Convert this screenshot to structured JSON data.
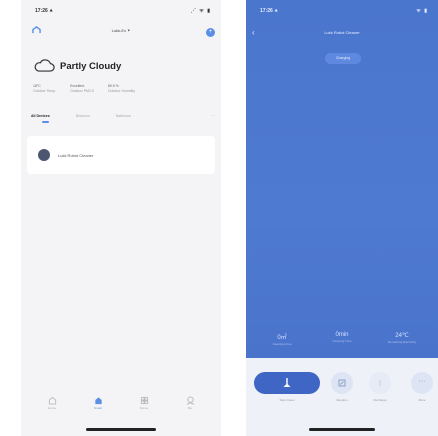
{
  "left": {
    "status_bar": {
      "time": "17:26 ⯅",
      "icons": "⋰ ᯤ ▮"
    },
    "header": {
      "home_name": "Lukk-Ex ⯆"
    },
    "weather": {
      "condition": "Partly Cloudy"
    },
    "stats": [
      {
        "value": "18°C",
        "label": "Outdoor Temp."
      },
      {
        "value": "Excellent",
        "label": "Outdoor PM2.5"
      },
      {
        "value": "69.5 %",
        "label": "Outdoor Humidity"
      }
    ],
    "tabs": [
      {
        "label": "All Devices"
      },
      {
        "label": "Bedroom"
      },
      {
        "label": "Bathroom"
      }
    ],
    "tabs_more": "···",
    "device": {
      "name": "Lukk Robot Cleaner"
    },
    "nav": [
      {
        "label": "Home",
        "icon": "home-icon"
      },
      {
        "label": "Smart",
        "icon": "smart-icon"
      },
      {
        "label": "Scene",
        "icon": "scene-icon"
      },
      {
        "label": "Me",
        "icon": "me-icon"
      }
    ],
    "accent": "#5b8fe6"
  },
  "right": {
    "status_bar": {
      "time": "17:26 ⯅",
      "icons": "ᯤ ▮"
    },
    "back": "‹",
    "title": "Lukk Robot Cleaner",
    "status": "Charging",
    "metrics": [
      {
        "value": "0㎡",
        "label": "Cleaning Area"
      },
      {
        "value": "0min",
        "label": "Cleaning Time"
      },
      {
        "value": "24℃",
        "label": "Remaining Electricity"
      }
    ],
    "actions": [
      {
        "label": "Start Clean"
      },
      {
        "label": "Random"
      },
      {
        "label": "Recharge"
      },
      {
        "label": "More",
        "glyph": "···"
      }
    ],
    "bg_color": "#4b76cd"
  }
}
